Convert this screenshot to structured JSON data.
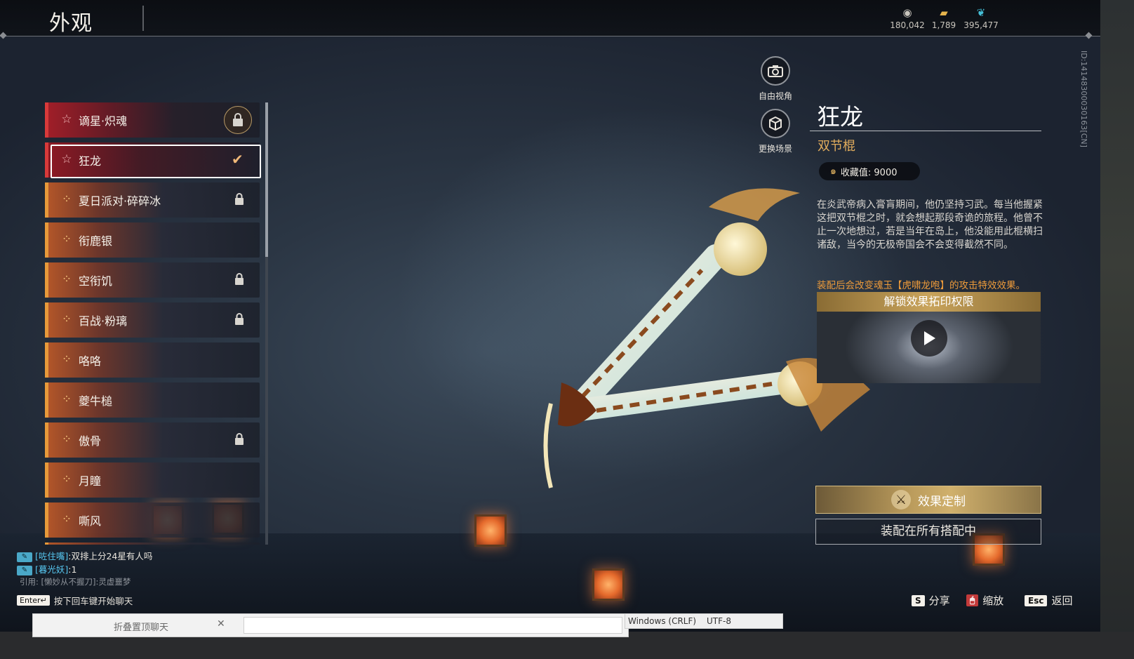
{
  "header": {
    "title": "外观",
    "currencies": [
      {
        "icon": "silver-coin-icon",
        "value": "180,042",
        "color": "#c9c5bd"
      },
      {
        "icon": "gold-ingot-icon",
        "value": "1,789",
        "color": "#e6b44c"
      },
      {
        "icon": "jade-feather-icon",
        "value": "395,477",
        "color": "#45c0d8"
      }
    ],
    "uid": "ID:1414830003016​3[CN]"
  },
  "list": {
    "items": [
      {
        "name": "谪星·炽魂",
        "tier": "red",
        "locked": true,
        "selected": false
      },
      {
        "name": "狂龙",
        "tier": "red",
        "locked": false,
        "selected": true
      },
      {
        "name": "夏日派对·碎碎冰",
        "tier": "gold",
        "locked": true,
        "selected": false
      },
      {
        "name": "衔鹿银",
        "tier": "gold",
        "locked": false,
        "selected": false
      },
      {
        "name": "空衔饥",
        "tier": "gold",
        "locked": true,
        "selected": false
      },
      {
        "name": "百战·粉璃",
        "tier": "gold",
        "locked": true,
        "selected": false
      },
      {
        "name": "咯咯",
        "tier": "gold",
        "locked": false,
        "selected": false
      },
      {
        "name": "夔牛槌",
        "tier": "gold",
        "locked": false,
        "selected": false
      },
      {
        "name": "傲骨",
        "tier": "gold",
        "locked": true,
        "selected": false
      },
      {
        "name": "月瞳",
        "tier": "gold",
        "locked": false,
        "selected": false
      },
      {
        "name": "嘶风",
        "tier": "gold",
        "locked": false,
        "selected": false
      }
    ]
  },
  "view_buttons": {
    "free_view": "自由视角",
    "change_scene": "更换场景"
  },
  "detail": {
    "name": "狂龙",
    "type": "双节棍",
    "collect_label": "收藏值: 9000",
    "lore": "在炎武帝病入膏肓期间，他仍坚持习武。每当他握紧这把双节棍之时，就会想起那段奇诡的旅程。他曾不止一次地想过，若是当年在岛上，他没能用此棍横扫诸敌，当今的无极帝国会不会变得截然不同。",
    "effect_note": "装配后会改变魂玉【虎啸龙咆】的攻击特效效果。",
    "unlock_banner": "解锁效果拓印权限",
    "custom_button": "效果定制",
    "equip_button": "装配在所有搭配中"
  },
  "chat": {
    "lines": [
      {
        "who": "[咗住嘴]",
        "msg": ":双排上分24星有人吗"
      },
      {
        "who": "[暮光妖]",
        "msg": ":1"
      }
    ],
    "quote": "引用: [懒妙从不握刀]:灵虚噩梦",
    "enter_key": "Enter↵",
    "enter_hint": "按下回车键开始聊天"
  },
  "hotkeys": [
    {
      "key": "S",
      "label": "分享"
    },
    {
      "key": "🖱",
      "label": "缩放"
    },
    {
      "key": "Esc",
      "label": "返回"
    }
  ],
  "desktop": {
    "window_title": "折叠置顶聊天",
    "line_ending": "Windows (CRLF)",
    "encoding": "UTF-8"
  }
}
